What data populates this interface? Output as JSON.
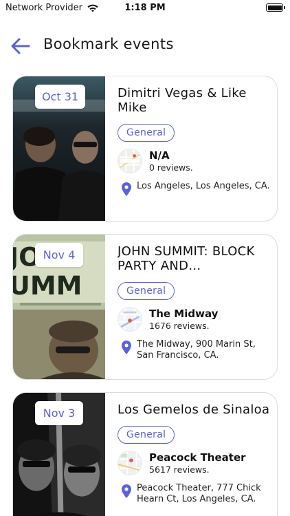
{
  "status_bar": {
    "carrier": "Network Provider",
    "time": "1:18 PM",
    "icons": [
      "wifi-icon",
      "battery-icon"
    ]
  },
  "header": {
    "title": "Bookmark events",
    "back_icon": "arrow-left-icon"
  },
  "colors": {
    "accent": "#5a62d8",
    "card_border": "#dcdcdc"
  },
  "events": [
    {
      "date": "Oct 31",
      "title": "Dimitri Vegas & Like Mike",
      "category": "General",
      "venue_name": "N/A",
      "venue_reviews": "0 reviews.",
      "address": "Los Angeles, Los Angeles, CA."
    },
    {
      "date": "Nov 4",
      "title": "JOHN SUMMIT: BLOCK PARTY AND…",
      "category": "General",
      "venue_name": "The Midway",
      "venue_reviews": "1676 reviews.",
      "address": "The Midway, 900 Marin St, San Francisco, CA."
    },
    {
      "date": "Nov 3",
      "title": "Los Gemelos de Sinaloa",
      "category": "General",
      "venue_name": "Peacock Theater",
      "venue_reviews": "5617 reviews.",
      "address": "Peacock Theater, 777 Chick Hearn Ct, Los Angeles, CA."
    }
  ]
}
